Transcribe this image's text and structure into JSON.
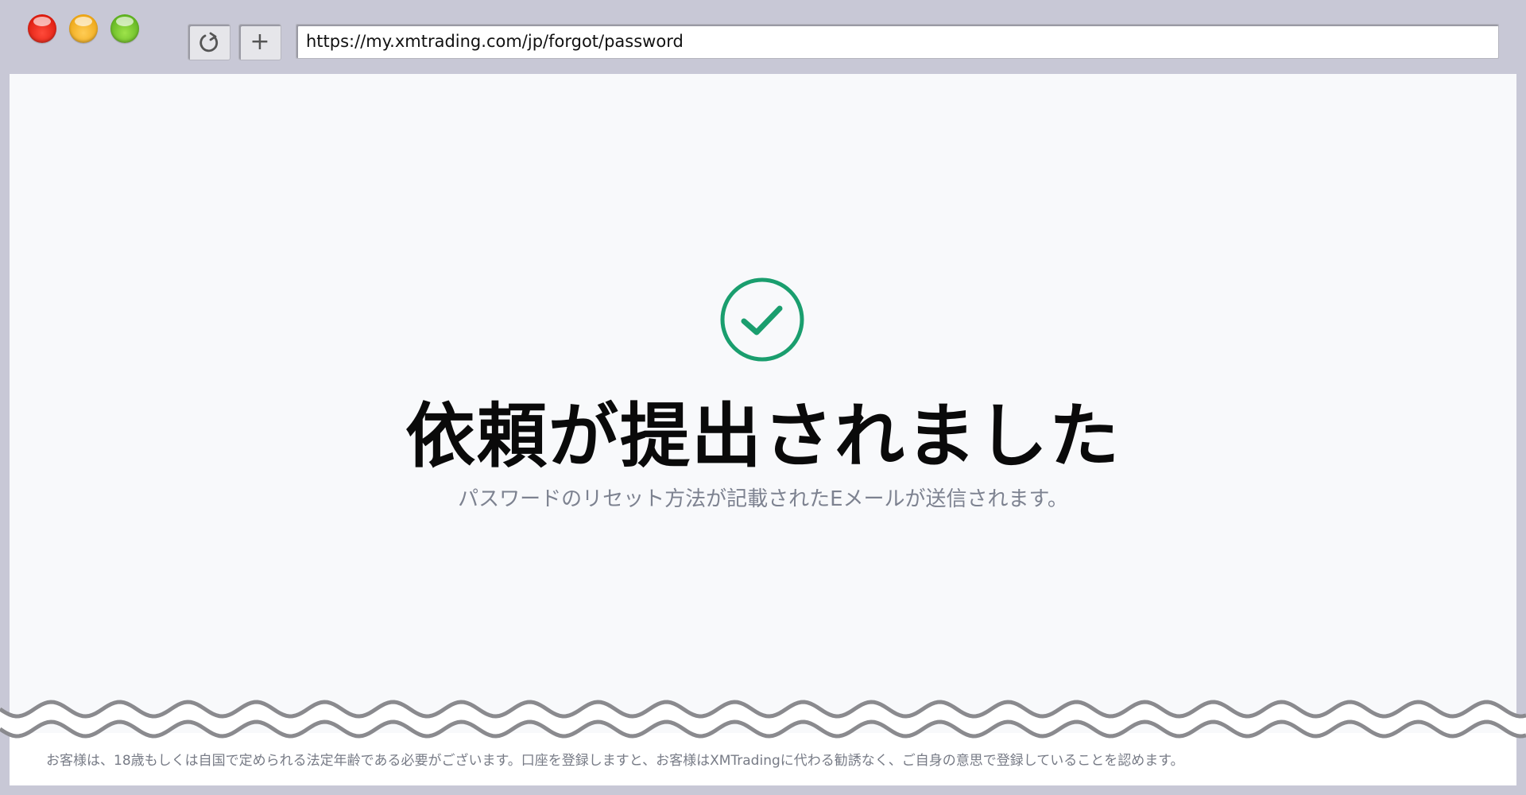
{
  "browser": {
    "url": "https://my.xmtrading.com/jp/forgot/password",
    "refresh_icon": "refresh-icon",
    "new_tab_label": "+"
  },
  "main": {
    "status_icon": "check-circle-icon",
    "title": "依頼が提出されました",
    "message": "パスワードのリセット方法が記載されたEメールが送信されます。"
  },
  "footer": {
    "disclaimer": "お客様は、18歳もしくは自国で定められる法定年齢である必要がございます。口座を登録しますと、お客様はXMTradingに代わる勧誘なく、ご自身の意思で登録していることを認めます。"
  },
  "colors": {
    "accent_green": "#1a9e6e",
    "title_text": "#0a0a0a",
    "muted_text": "#7d8290"
  }
}
